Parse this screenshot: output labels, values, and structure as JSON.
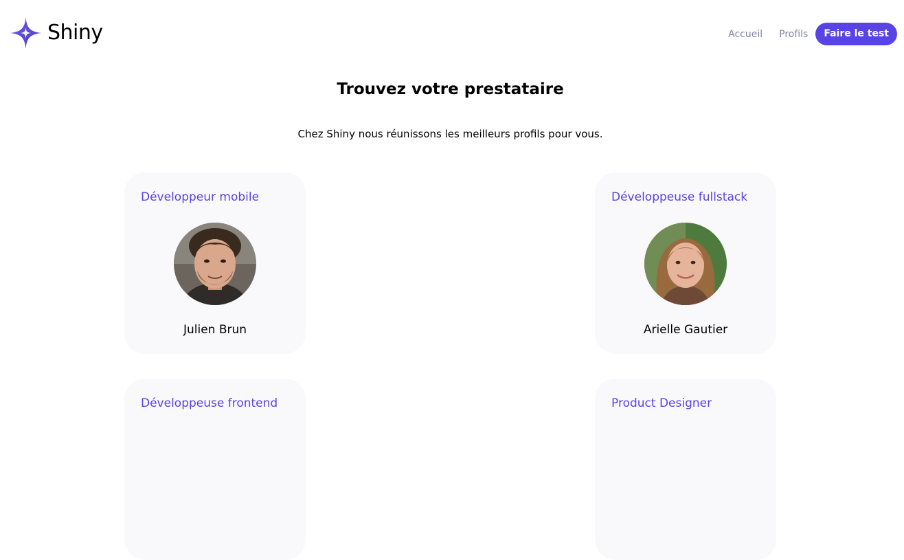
{
  "brand": {
    "name": "Shiny",
    "color": "#5843e4"
  },
  "nav": {
    "home_label": "Accueil",
    "profiles_label": "Profils",
    "cta_label": "Faire le test"
  },
  "hero": {
    "title": "Trouvez votre prestataire",
    "subtitle": "Chez Shiny nous réunissons les meilleurs profils pour vous."
  },
  "cards": [
    {
      "job": "Développeur mobile",
      "name": "Julien Brun"
    },
    {
      "job": "Développeuse fullstack",
      "name": "Arielle Gautier"
    },
    {
      "job": "Développeuse frontend",
      "name": ""
    },
    {
      "job": "Product Designer",
      "name": ""
    }
  ]
}
